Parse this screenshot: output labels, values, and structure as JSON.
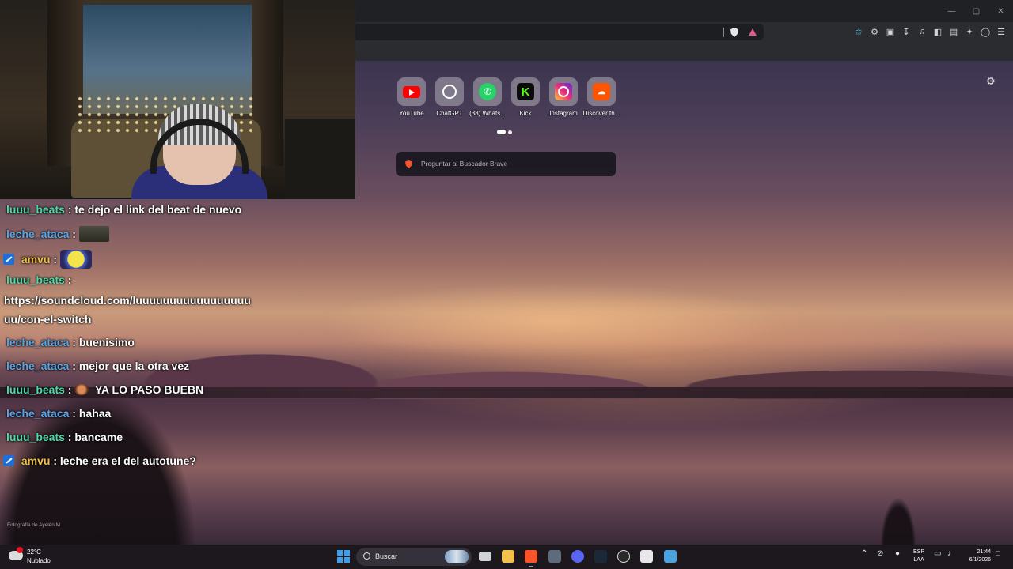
{
  "browser": {
    "tiles": [
      {
        "label": "YouTube",
        "icon": "youtube-icon"
      },
      {
        "label": "ChatGPT",
        "icon": "chatgpt-icon"
      },
      {
        "label": "(38) Whats...",
        "icon": "whatsapp-icon"
      },
      {
        "label": "Kick",
        "icon": "kick-icon"
      },
      {
        "label": "Instagram",
        "icon": "instagram-icon"
      },
      {
        "label": "Discover th...",
        "icon": "soundcloud-icon"
      }
    ],
    "search_placeholder": "Preguntar al Buscador Brave",
    "photo_credit": "Fotografía de Ayelén M",
    "toolbar_icons": [
      "translate-icon",
      "extensions-icon",
      "tab-search-icon",
      "download-icon",
      "media-icon",
      "sidebar-icon",
      "wallet-icon",
      "leo-ai-icon",
      "vpn-shield-icon",
      "menu-icon"
    ]
  },
  "chat": {
    "messages": [
      {
        "user": "luuu_beats",
        "text": "te dejo el link del beat de nuevo"
      },
      {
        "user": "leche_ataca",
        "text": ""
      },
      {
        "user": "amvu",
        "text": ""
      },
      {
        "user": "luuu_beats",
        "text": ""
      },
      {
        "link_line1": "https://soundcloud.com/luuuuuuuuuuuuuuuuu",
        "link_line2": "uu/con-el-switch"
      },
      {
        "user": "leche_ataca",
        "text": "buenisimo"
      },
      {
        "user": "leche_ataca",
        "text": "mejor que la otra vez"
      },
      {
        "user": "luuu_beats",
        "text": "YA LO PASO BUEBN"
      },
      {
        "user": "leche_ataca",
        "text": "hahaa"
      },
      {
        "user": "luuu_beats",
        "text": "bancame"
      },
      {
        "user": "amvu",
        "text": "leche era el del autotune?"
      }
    ],
    "separator": ":",
    "colors": {
      "luuu_beats": "#4fd8a8",
      "leche_ataca": "#5aa6e8",
      "amvu": "#f0c24c"
    }
  },
  "taskbar": {
    "weather_temp": "22°C",
    "weather_desc": "Nublado",
    "search_label": "Buscar",
    "lang_line1": "ESP",
    "lang_line2": "LAA",
    "time": "21:44",
    "date": "6/1/2026"
  }
}
